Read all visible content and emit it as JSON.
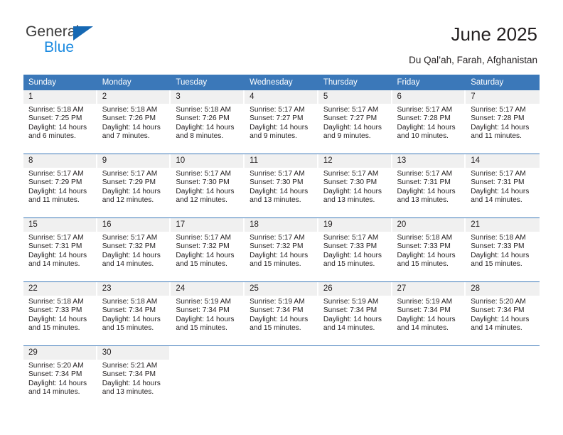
{
  "brand": {
    "name_part1": "General",
    "name_part2": "Blue",
    "triangle_icon": "triangle-icon",
    "accent_color": "#1668b3",
    "secondary_color": "#1b8ae0"
  },
  "header": {
    "title": "June 2025",
    "subtitle": "Du Qal’ah, Farah, Afghanistan"
  },
  "calendar": {
    "header_bg": "#3b78b9",
    "header_text_color": "#ffffff",
    "daynum_bg": "#f0f0f0",
    "weekdays": [
      "Sunday",
      "Monday",
      "Tuesday",
      "Wednesday",
      "Thursday",
      "Friday",
      "Saturday"
    ],
    "weeks": [
      [
        {
          "day": "1",
          "sunrise": "Sunrise: 5:18 AM",
          "sunset": "Sunset: 7:25 PM",
          "daylight_line1": "Daylight: 14 hours",
          "daylight_line2": "and 6 minutes."
        },
        {
          "day": "2",
          "sunrise": "Sunrise: 5:18 AM",
          "sunset": "Sunset: 7:26 PM",
          "daylight_line1": "Daylight: 14 hours",
          "daylight_line2": "and 7 minutes."
        },
        {
          "day": "3",
          "sunrise": "Sunrise: 5:18 AM",
          "sunset": "Sunset: 7:26 PM",
          "daylight_line1": "Daylight: 14 hours",
          "daylight_line2": "and 8 minutes."
        },
        {
          "day": "4",
          "sunrise": "Sunrise: 5:17 AM",
          "sunset": "Sunset: 7:27 PM",
          "daylight_line1": "Daylight: 14 hours",
          "daylight_line2": "and 9 minutes."
        },
        {
          "day": "5",
          "sunrise": "Sunrise: 5:17 AM",
          "sunset": "Sunset: 7:27 PM",
          "daylight_line1": "Daylight: 14 hours",
          "daylight_line2": "and 9 minutes."
        },
        {
          "day": "6",
          "sunrise": "Sunrise: 5:17 AM",
          "sunset": "Sunset: 7:28 PM",
          "daylight_line1": "Daylight: 14 hours",
          "daylight_line2": "and 10 minutes."
        },
        {
          "day": "7",
          "sunrise": "Sunrise: 5:17 AM",
          "sunset": "Sunset: 7:28 PM",
          "daylight_line1": "Daylight: 14 hours",
          "daylight_line2": "and 11 minutes."
        }
      ],
      [
        {
          "day": "8",
          "sunrise": "Sunrise: 5:17 AM",
          "sunset": "Sunset: 7:29 PM",
          "daylight_line1": "Daylight: 14 hours",
          "daylight_line2": "and 11 minutes."
        },
        {
          "day": "9",
          "sunrise": "Sunrise: 5:17 AM",
          "sunset": "Sunset: 7:29 PM",
          "daylight_line1": "Daylight: 14 hours",
          "daylight_line2": "and 12 minutes."
        },
        {
          "day": "10",
          "sunrise": "Sunrise: 5:17 AM",
          "sunset": "Sunset: 7:30 PM",
          "daylight_line1": "Daylight: 14 hours",
          "daylight_line2": "and 12 minutes."
        },
        {
          "day": "11",
          "sunrise": "Sunrise: 5:17 AM",
          "sunset": "Sunset: 7:30 PM",
          "daylight_line1": "Daylight: 14 hours",
          "daylight_line2": "and 13 minutes."
        },
        {
          "day": "12",
          "sunrise": "Sunrise: 5:17 AM",
          "sunset": "Sunset: 7:30 PM",
          "daylight_line1": "Daylight: 14 hours",
          "daylight_line2": "and 13 minutes."
        },
        {
          "day": "13",
          "sunrise": "Sunrise: 5:17 AM",
          "sunset": "Sunset: 7:31 PM",
          "daylight_line1": "Daylight: 14 hours",
          "daylight_line2": "and 13 minutes."
        },
        {
          "day": "14",
          "sunrise": "Sunrise: 5:17 AM",
          "sunset": "Sunset: 7:31 PM",
          "daylight_line1": "Daylight: 14 hours",
          "daylight_line2": "and 14 minutes."
        }
      ],
      [
        {
          "day": "15",
          "sunrise": "Sunrise: 5:17 AM",
          "sunset": "Sunset: 7:31 PM",
          "daylight_line1": "Daylight: 14 hours",
          "daylight_line2": "and 14 minutes."
        },
        {
          "day": "16",
          "sunrise": "Sunrise: 5:17 AM",
          "sunset": "Sunset: 7:32 PM",
          "daylight_line1": "Daylight: 14 hours",
          "daylight_line2": "and 14 minutes."
        },
        {
          "day": "17",
          "sunrise": "Sunrise: 5:17 AM",
          "sunset": "Sunset: 7:32 PM",
          "daylight_line1": "Daylight: 14 hours",
          "daylight_line2": "and 15 minutes."
        },
        {
          "day": "18",
          "sunrise": "Sunrise: 5:17 AM",
          "sunset": "Sunset: 7:32 PM",
          "daylight_line1": "Daylight: 14 hours",
          "daylight_line2": "and 15 minutes."
        },
        {
          "day": "19",
          "sunrise": "Sunrise: 5:17 AM",
          "sunset": "Sunset: 7:33 PM",
          "daylight_line1": "Daylight: 14 hours",
          "daylight_line2": "and 15 minutes."
        },
        {
          "day": "20",
          "sunrise": "Sunrise: 5:18 AM",
          "sunset": "Sunset: 7:33 PM",
          "daylight_line1": "Daylight: 14 hours",
          "daylight_line2": "and 15 minutes."
        },
        {
          "day": "21",
          "sunrise": "Sunrise: 5:18 AM",
          "sunset": "Sunset: 7:33 PM",
          "daylight_line1": "Daylight: 14 hours",
          "daylight_line2": "and 15 minutes."
        }
      ],
      [
        {
          "day": "22",
          "sunrise": "Sunrise: 5:18 AM",
          "sunset": "Sunset: 7:33 PM",
          "daylight_line1": "Daylight: 14 hours",
          "daylight_line2": "and 15 minutes."
        },
        {
          "day": "23",
          "sunrise": "Sunrise: 5:18 AM",
          "sunset": "Sunset: 7:34 PM",
          "daylight_line1": "Daylight: 14 hours",
          "daylight_line2": "and 15 minutes."
        },
        {
          "day": "24",
          "sunrise": "Sunrise: 5:19 AM",
          "sunset": "Sunset: 7:34 PM",
          "daylight_line1": "Daylight: 14 hours",
          "daylight_line2": "and 15 minutes."
        },
        {
          "day": "25",
          "sunrise": "Sunrise: 5:19 AM",
          "sunset": "Sunset: 7:34 PM",
          "daylight_line1": "Daylight: 14 hours",
          "daylight_line2": "and 15 minutes."
        },
        {
          "day": "26",
          "sunrise": "Sunrise: 5:19 AM",
          "sunset": "Sunset: 7:34 PM",
          "daylight_line1": "Daylight: 14 hours",
          "daylight_line2": "and 14 minutes."
        },
        {
          "day": "27",
          "sunrise": "Sunrise: 5:19 AM",
          "sunset": "Sunset: 7:34 PM",
          "daylight_line1": "Daylight: 14 hours",
          "daylight_line2": "and 14 minutes."
        },
        {
          "day": "28",
          "sunrise": "Sunrise: 5:20 AM",
          "sunset": "Sunset: 7:34 PM",
          "daylight_line1": "Daylight: 14 hours",
          "daylight_line2": "and 14 minutes."
        }
      ],
      [
        {
          "day": "29",
          "sunrise": "Sunrise: 5:20 AM",
          "sunset": "Sunset: 7:34 PM",
          "daylight_line1": "Daylight: 14 hours",
          "daylight_line2": "and 14 minutes."
        },
        {
          "day": "30",
          "sunrise": "Sunrise: 5:21 AM",
          "sunset": "Sunset: 7:34 PM",
          "daylight_line1": "Daylight: 14 hours",
          "daylight_line2": "and 13 minutes."
        },
        {
          "day": "",
          "sunrise": "",
          "sunset": "",
          "daylight_line1": "",
          "daylight_line2": ""
        },
        {
          "day": "",
          "sunrise": "",
          "sunset": "",
          "daylight_line1": "",
          "daylight_line2": ""
        },
        {
          "day": "",
          "sunrise": "",
          "sunset": "",
          "daylight_line1": "",
          "daylight_line2": ""
        },
        {
          "day": "",
          "sunrise": "",
          "sunset": "",
          "daylight_line1": "",
          "daylight_line2": ""
        },
        {
          "day": "",
          "sunrise": "",
          "sunset": "",
          "daylight_line1": "",
          "daylight_line2": ""
        }
      ]
    ]
  }
}
